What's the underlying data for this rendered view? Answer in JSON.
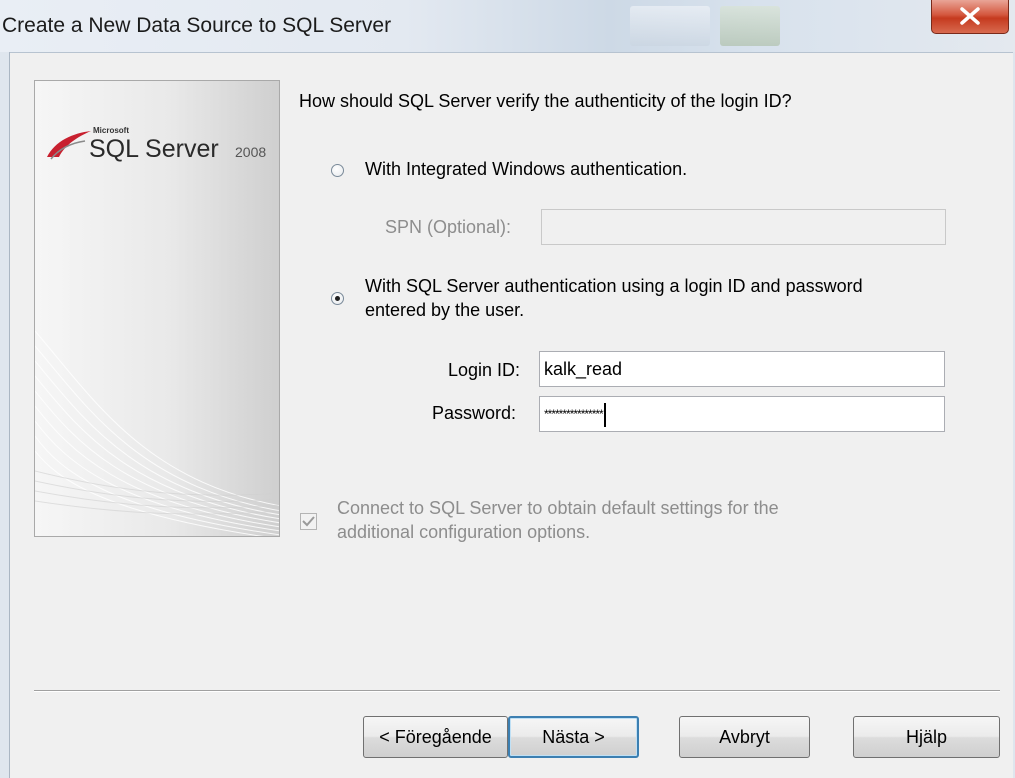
{
  "window": {
    "title": "Create a New Data Source to SQL Server"
  },
  "banner": {
    "logo_small": "Microsoft",
    "logo_product": "SQL Server",
    "logo_version": "2008"
  },
  "auth": {
    "question": "How should SQL Server verify the authenticity of the login ID?",
    "integrated_label": "With Integrated Windows authentication.",
    "integrated_selected": false,
    "spn_label": "SPN (Optional):",
    "spn_value": "",
    "sql_label_line1": "With SQL Server authentication using a login ID and password",
    "sql_label_line2": "entered by the user.",
    "sql_selected": true,
    "login_label": "Login ID:",
    "login_value": "kalk_read",
    "password_label": "Password:",
    "password_value": "****************"
  },
  "connect": {
    "label_line1": "Connect to SQL Server to obtain default settings for the",
    "label_line2": "additional configuration options.",
    "checked": true
  },
  "buttons": {
    "back": "< Föregående",
    "next": "Nästa >",
    "cancel": "Avbryt",
    "help": "Hjälp"
  },
  "colors": {
    "disabled_text": "#8d8d8d",
    "close_button": "#c53a1f",
    "default_button_border": "#3c7fb1"
  }
}
